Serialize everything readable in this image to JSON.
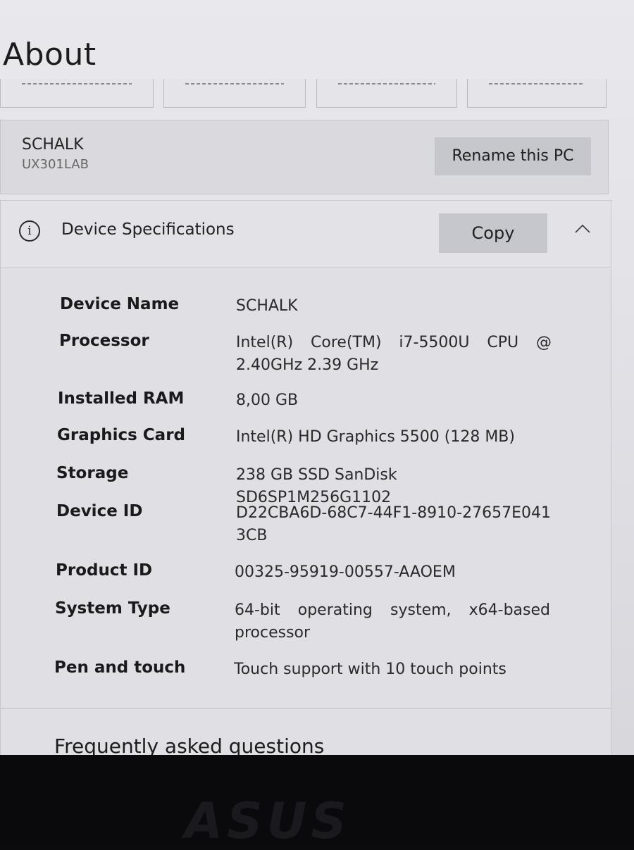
{
  "page": {
    "title": "About"
  },
  "pc": {
    "name": "SCHALK",
    "model": "UX301LAB",
    "rename_label": "Rename this PC"
  },
  "specs": {
    "title": "Device Specifications",
    "copy_label": "Copy",
    "info_icon": "info-icon",
    "collapse_icon": "chevron-up-icon",
    "rows": [
      {
        "label": "Device Name",
        "value": "SCHALK"
      },
      {
        "label": "Processor",
        "value": "Intel(R) Core(TM) i7-5500U CPU @ 2.40GHz 2.39 GHz"
      },
      {
        "label": "Installed RAM",
        "value": "8,00 GB"
      },
      {
        "label": "Graphics Card",
        "value": "Intel(R) HD Graphics 5500 (128 MB)"
      },
      {
        "label": "Storage",
        "value": "238 GB SSD SanDisk SD6SP1M256G1102"
      },
      {
        "label": "Device ID",
        "value": "D22CBA6D-68C7-44F1-8910-27657E0413CB"
      },
      {
        "label": "Product ID",
        "value": "00325-95919-00557-AAOEM"
      },
      {
        "label": "System Type",
        "value": "64-bit operating system, x64-based processor"
      },
      {
        "label": "Pen and touch",
        "value": "Touch support with 10 touch points"
      }
    ]
  },
  "faq": {
    "title": "Frequently asked questions"
  },
  "laptop": {
    "brand": "ASUS"
  },
  "colors": {
    "button_bg": "#c6c6cd",
    "card_bg": "#e0e0e4",
    "bezel": "#0a0a0c"
  }
}
